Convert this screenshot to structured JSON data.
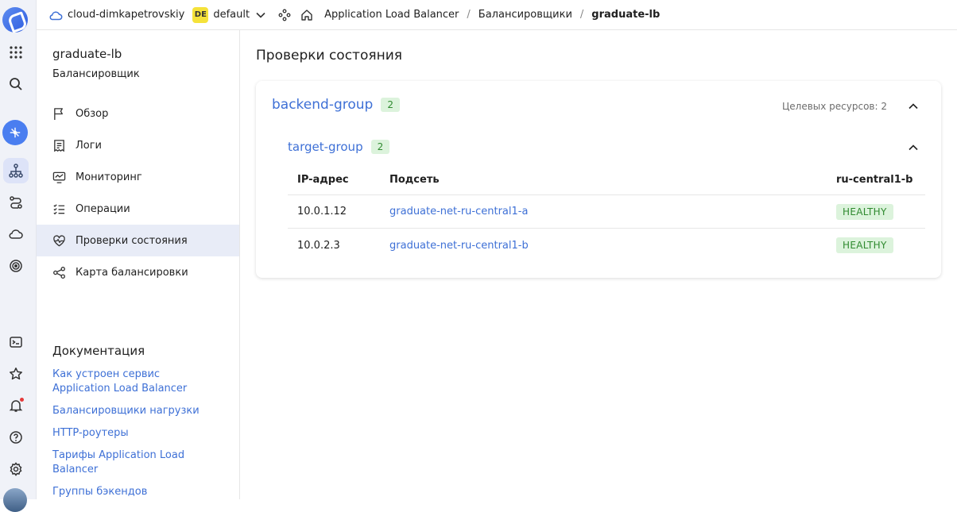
{
  "topbar": {
    "cloud_name": "cloud-dimkapetrovskiy",
    "folder_badge": "DE",
    "folder_name": "default",
    "breadcrumbs": [
      "Application Load Balancer",
      "Балансировщики",
      "graduate-lb"
    ],
    "separator": "/"
  },
  "sidebar": {
    "title": "graduate-lb",
    "subtitle": "Балансировщик",
    "items": [
      {
        "label": "Обзор",
        "icon": "flag-icon"
      },
      {
        "label": "Логи",
        "icon": "logs-icon"
      },
      {
        "label": "Мониторинг",
        "icon": "monitoring-icon"
      },
      {
        "label": "Операции",
        "icon": "operations-icon"
      },
      {
        "label": "Проверки состояния",
        "icon": "heart-pulse-icon",
        "active": true
      },
      {
        "label": "Карта балансировки",
        "icon": "map-icon"
      }
    ],
    "docs_title": "Документация",
    "docs": [
      "Как устроен сервис Application Load Balancer",
      "Балансировщики нагрузки",
      "HTTP-роутеры",
      "Тарифы Application Load Balancer",
      "Группы бэкендов"
    ]
  },
  "main": {
    "page_title": "Проверки состояния",
    "backend_group": {
      "name": "backend-group",
      "count": "2",
      "targets_text": "Целевых ресурсов: 2",
      "target_group": {
        "name": "target-group",
        "count": "2",
        "columns": [
          "IP-адрес",
          "Подсеть",
          "ru-central1-b"
        ],
        "rows": [
          {
            "ip": "10.0.1.12",
            "subnet": "graduate-net-ru-central1-a",
            "status": "HEALTHY"
          },
          {
            "ip": "10.0.2.3",
            "subnet": "graduate-net-ru-central1-b",
            "status": "HEALTHY"
          }
        ]
      }
    }
  },
  "colors": {
    "accent": "#3e70d6",
    "healthy_bg": "#dcf3dc",
    "healthy_text": "#2f8a2f",
    "active_nav_bg": "#e8ecf7",
    "folder_badge_bg": "#f5e23a"
  }
}
